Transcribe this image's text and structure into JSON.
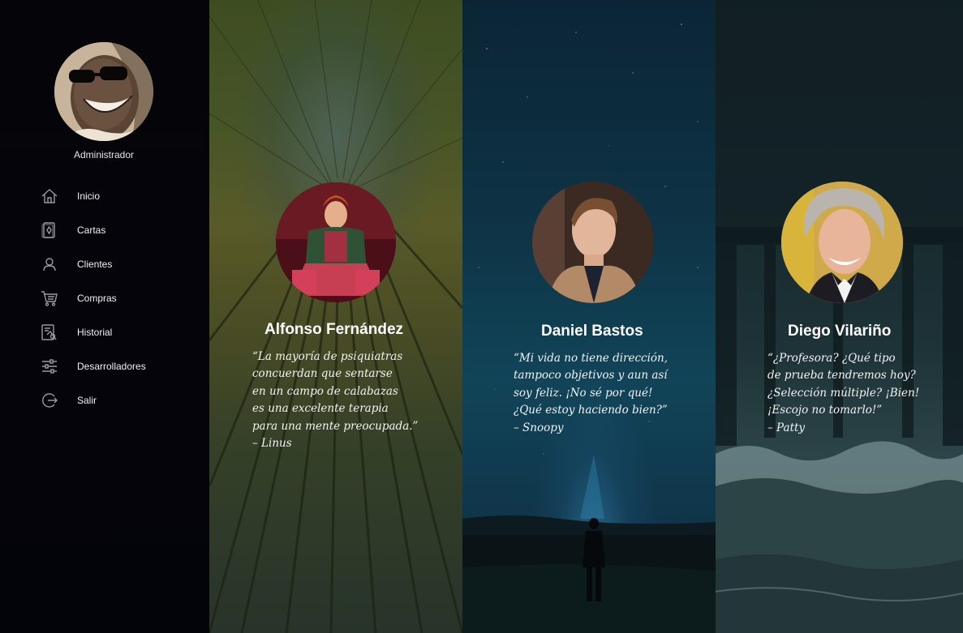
{
  "sidebar": {
    "user_role": "Administrador",
    "items": [
      {
        "label": "Inicio",
        "icon": "home-icon"
      },
      {
        "label": "Cartas",
        "icon": "cards-icon"
      },
      {
        "label": "Clientes",
        "icon": "user-icon"
      },
      {
        "label": "Compras",
        "icon": "cart-icon"
      },
      {
        "label": "Historial",
        "icon": "history-icon"
      },
      {
        "label": "Desarrolladores",
        "icon": "sliders-icon"
      },
      {
        "label": "Salir",
        "icon": "logout-icon"
      }
    ]
  },
  "developers": [
    {
      "name": "Alfonso Fernández",
      "quote_lines": [
        "“La mayoría de psiquiatras",
        "concuerdan que sentarse",
        "en un campo de calabazas",
        "es una excelente terapia",
        "para una mente preocupada.”",
        "– Linus"
      ]
    },
    {
      "name": "Daniel Bastos",
      "quote_lines": [
        "“Mi vida no tiene dirección,",
        "tampoco objetivos y aun así",
        "soy feliz. ¡No sé por qué!",
        "¿Qué estoy haciendo bien?”",
        "– Snoopy"
      ]
    },
    {
      "name": "Diego Vilariño",
      "quote_lines": [
        "“¿Profesora? ¿Qué tipo",
        "de prueba tendremos hoy?",
        "¿Selección múltiple? ¡Bien!",
        "¡Escojo no tomarlo!”",
        "– Patty"
      ]
    }
  ],
  "colors": {
    "sidebar_bg": "#05050b",
    "text": "#ffffff",
    "panel_forest": "#55632e",
    "panel_night": "#0e3345",
    "panel_sea": "#1d3337"
  }
}
